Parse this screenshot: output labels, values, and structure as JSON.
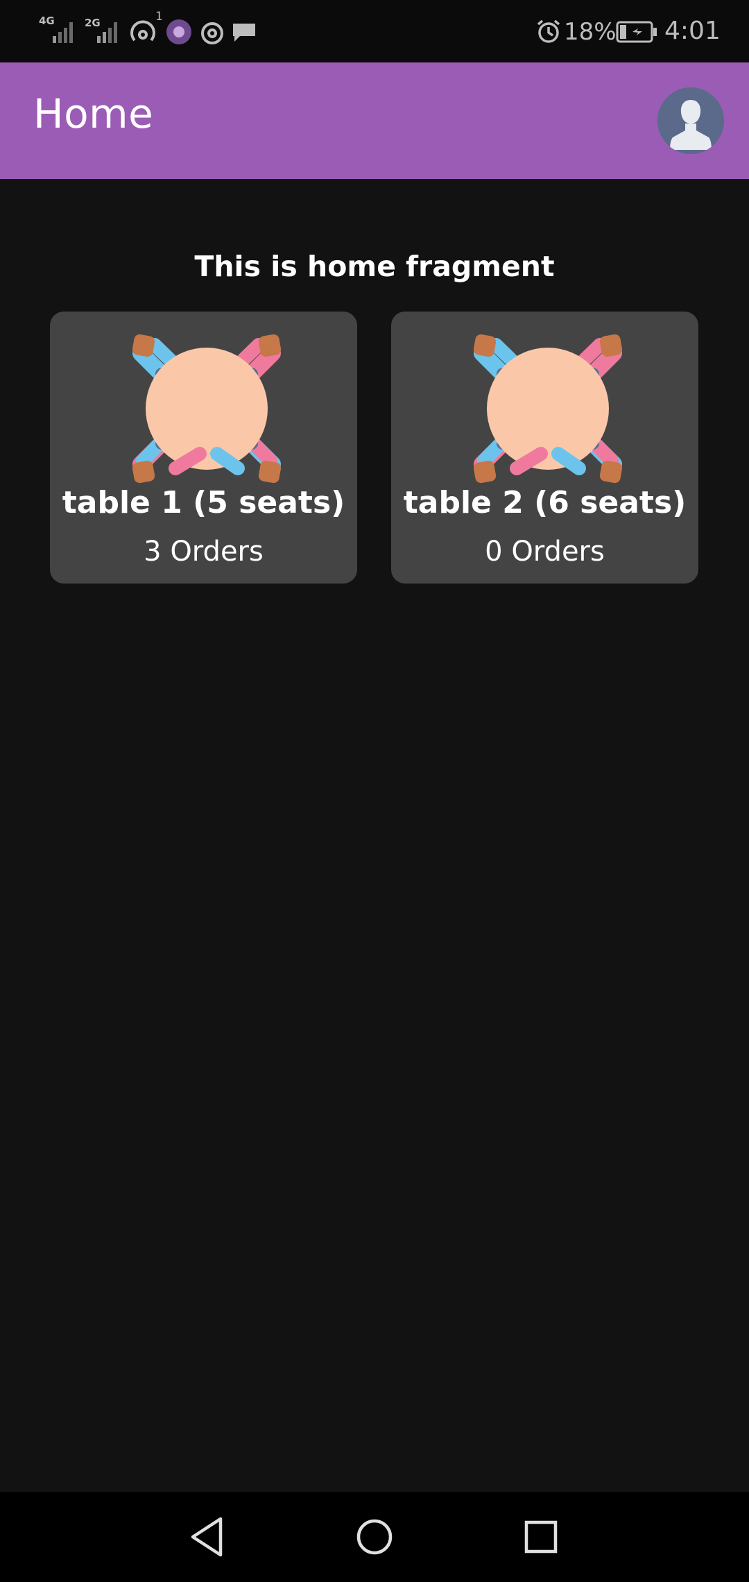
{
  "status_bar": {
    "network1": "4G",
    "network2": "2G",
    "notif_count": "1",
    "battery": "18%",
    "time": "4:01"
  },
  "app_bar": {
    "title": "Home",
    "color": "#9b5cb6"
  },
  "main": {
    "heading": "This is home fragment",
    "tables": [
      {
        "title": "table 1 (5 seats)",
        "orders": "3 Orders",
        "icon": "dining-table-icon"
      },
      {
        "title": "table 2 (6 seats)",
        "orders": "0 Orders",
        "icon": "dining-table-icon"
      }
    ]
  },
  "nav_bar": {
    "icons": [
      "back-icon",
      "home-icon",
      "recents-icon"
    ]
  }
}
